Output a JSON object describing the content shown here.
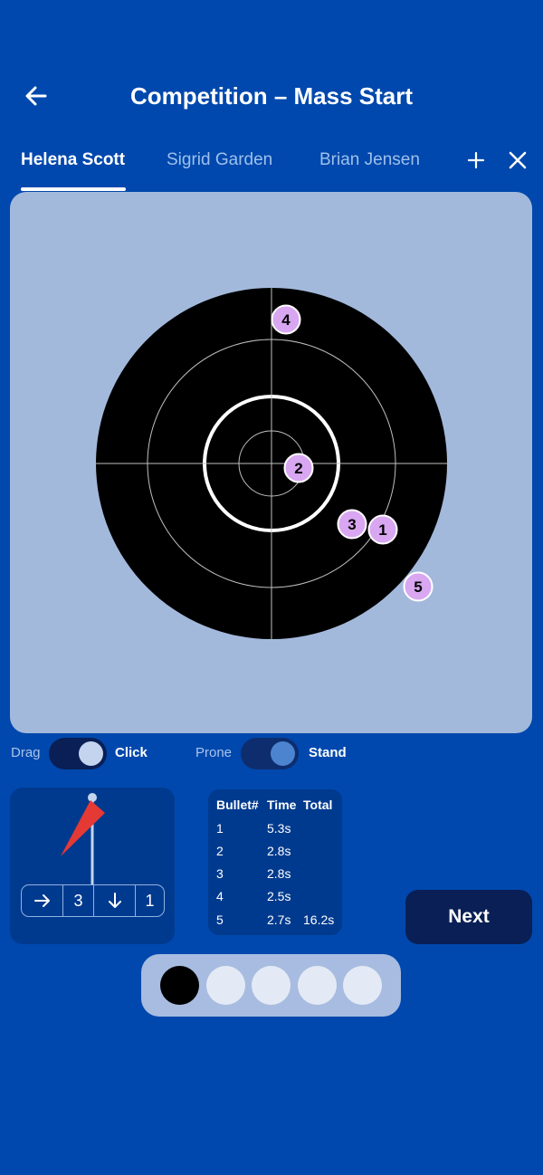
{
  "header": {
    "title": "Competition – Mass Start",
    "back_icon": "arrow-left-icon"
  },
  "tabs": [
    {
      "label": "Helena Scott",
      "active": true
    },
    {
      "label": "Sigrid Garden",
      "active": false
    },
    {
      "label": "Brian Jensen",
      "active": false
    }
  ],
  "tab_actions": {
    "add_icon": "plus-icon",
    "close_icon": "close-icon"
  },
  "target": {
    "shots": [
      {
        "label": "1"
      },
      {
        "label": "2"
      },
      {
        "label": "3"
      },
      {
        "label": "4"
      },
      {
        "label": "5"
      }
    ],
    "colors": {
      "panel": "#A3B9DC",
      "target": "#000000",
      "marker": "#D9A6F2"
    }
  },
  "modes": {
    "input": {
      "left_label": "Drag",
      "right_label": "Click",
      "value": "Click"
    },
    "position": {
      "left_label": "Prone",
      "right_label": "Stand",
      "value": "Stand"
    }
  },
  "wind": {
    "flag_icon": "wind-flag-icon",
    "horizontal_icon": "arrow-right-icon",
    "horizontal_value": "3",
    "vertical_icon": "arrow-down-icon",
    "vertical_value": "1"
  },
  "stats": {
    "headers": {
      "bullet": "Bullet#",
      "time": "Time",
      "total": "Total"
    },
    "rows": [
      {
        "bullet": "1",
        "time": "5.3s",
        "total": ""
      },
      {
        "bullet": "2",
        "time": "2.8s",
        "total": ""
      },
      {
        "bullet": "3",
        "time": "2.8s",
        "total": ""
      },
      {
        "bullet": "4",
        "time": "2.5s",
        "total": ""
      },
      {
        "bullet": "5",
        "time": "2.7s",
        "total": "16.2s"
      }
    ]
  },
  "next_button": {
    "label": "Next"
  },
  "shot_indicators": {
    "states": [
      "hit",
      "empty",
      "empty",
      "empty",
      "empty"
    ],
    "colors": {
      "hit": "#000000",
      "empty": "#E4EAF5"
    }
  }
}
